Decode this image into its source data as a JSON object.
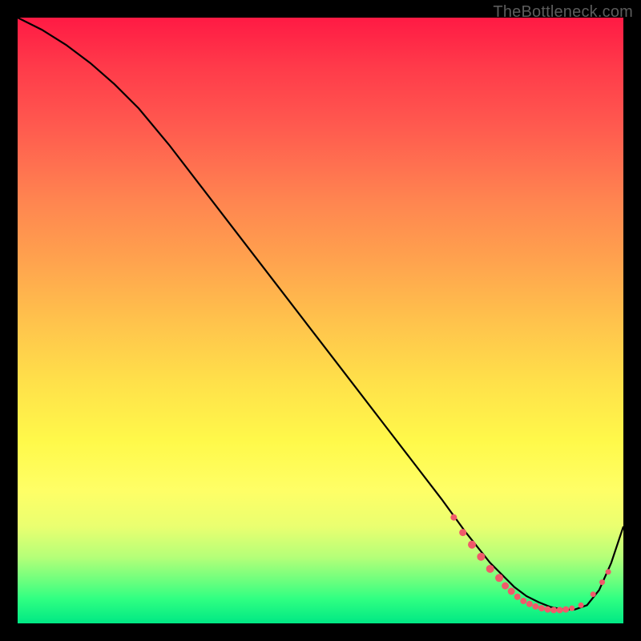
{
  "watermark": "TheBottleneck.com",
  "chart_data": {
    "type": "line",
    "title": "",
    "xlabel": "",
    "ylabel": "",
    "xlim": [
      0,
      100
    ],
    "ylim": [
      0,
      100
    ],
    "series": [
      {
        "name": "curve",
        "x": [
          0,
          4,
          8,
          12,
          16,
          20,
          25,
          30,
          35,
          40,
          45,
          50,
          55,
          60,
          65,
          70,
          74,
          78,
          80,
          82,
          84,
          86,
          88,
          90,
          92,
          94,
          96,
          98,
          100
        ],
        "y": [
          100,
          98,
          95.5,
          92.5,
          89,
          85,
          79,
          72.5,
          66,
          59.5,
          53,
          46.5,
          40,
          33.5,
          27,
          20.5,
          15,
          10,
          8,
          6,
          4.5,
          3.5,
          2.7,
          2.3,
          2.3,
          3.0,
          5.5,
          10,
          16
        ]
      }
    ],
    "markers": [
      {
        "x": 72.0,
        "y": 17.5,
        "r": 4
      },
      {
        "x": 73.5,
        "y": 15.0,
        "r": 4.5
      },
      {
        "x": 75.0,
        "y": 13.0,
        "r": 5
      },
      {
        "x": 76.5,
        "y": 11.0,
        "r": 5
      },
      {
        "x": 78.0,
        "y": 9.0,
        "r": 5
      },
      {
        "x": 79.5,
        "y": 7.5,
        "r": 5
      },
      {
        "x": 80.5,
        "y": 6.2,
        "r": 4.5
      },
      {
        "x": 81.5,
        "y": 5.3,
        "r": 4.5
      },
      {
        "x": 82.5,
        "y": 4.4,
        "r": 4
      },
      {
        "x": 83.5,
        "y": 3.7,
        "r": 4
      },
      {
        "x": 84.5,
        "y": 3.2,
        "r": 4
      },
      {
        "x": 85.5,
        "y": 2.8,
        "r": 4
      },
      {
        "x": 86.5,
        "y": 2.5,
        "r": 4
      },
      {
        "x": 87.5,
        "y": 2.3,
        "r": 4
      },
      {
        "x": 88.5,
        "y": 2.2,
        "r": 4
      },
      {
        "x": 89.5,
        "y": 2.2,
        "r": 4
      },
      {
        "x": 90.5,
        "y": 2.3,
        "r": 4
      },
      {
        "x": 91.5,
        "y": 2.5,
        "r": 3.5
      },
      {
        "x": 93.0,
        "y": 3.0,
        "r": 3.5
      },
      {
        "x": 95.0,
        "y": 4.8,
        "r": 3.5
      },
      {
        "x": 96.5,
        "y": 6.8,
        "r": 3.5
      },
      {
        "x": 97.5,
        "y": 8.5,
        "r": 3.5
      }
    ],
    "marker_color": "#f05a6a",
    "curve_color": "#000000"
  }
}
